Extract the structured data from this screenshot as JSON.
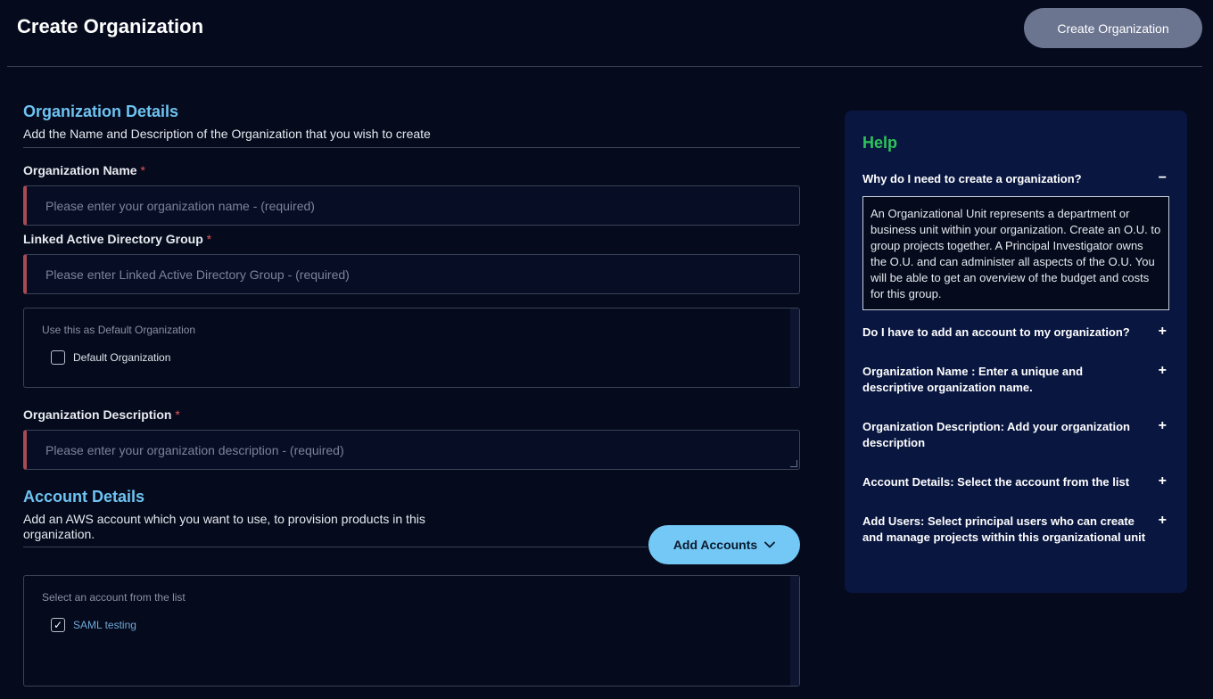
{
  "header": {
    "title": "Create Organization",
    "create_button": "Create Organization"
  },
  "org_details": {
    "title": "Organization Details",
    "description": "Add the Name and Description of the Organization that you wish to create",
    "name_label": "Organization Name",
    "name_placeholder": "Please enter your organization name - (required)",
    "ad_group_label": "Linked Active Directory Group",
    "ad_group_placeholder": "Please enter Linked Active Directory Group - (required)",
    "default_org_legend": "Use this as Default Organization",
    "default_org_checkbox": "Default Organization",
    "default_org_checked": false,
    "desc_label": "Organization Description",
    "desc_placeholder": "Please enter your organization description - (required)",
    "required_mark": "*"
  },
  "account_details": {
    "title": "Account Details",
    "description": "Add an AWS account which you want to use, to provision products in this organization.",
    "add_button": "Add Accounts",
    "list_legend": "Select an account from the list",
    "accounts": [
      {
        "label": "SAML testing",
        "checked": true
      }
    ]
  },
  "help": {
    "title": "Help",
    "items": [
      {
        "question": "Why do I need to create a organization?",
        "toggle": "−",
        "expanded": true,
        "answer": "An Organizational Unit represents a department or business unit within your organization. Create an O.U. to group projects together. A Principal Investigator owns the O.U. and can administer all aspects of the O.U. You will be able to get an overview of the budget and costs for this group."
      },
      {
        "question": "Do I have to add an account to my organization?",
        "toggle": "+"
      },
      {
        "question": "Organization Name : Enter a unique and descriptive organization name.",
        "toggle": "+"
      },
      {
        "question": "Organization Description: Add your organization description",
        "toggle": "+"
      },
      {
        "question": "Account Details: Select the account from the list",
        "toggle": "+"
      },
      {
        "question": "Add Users: Select principal users who can create and manage projects within this organizational unit",
        "toggle": "+"
      }
    ]
  },
  "colors": {
    "background": "#050a1c",
    "accent_blue": "#6ec3f2",
    "help_green": "#2ec45a",
    "required_red": "#e05555",
    "invalid_border": "#a84a52"
  }
}
